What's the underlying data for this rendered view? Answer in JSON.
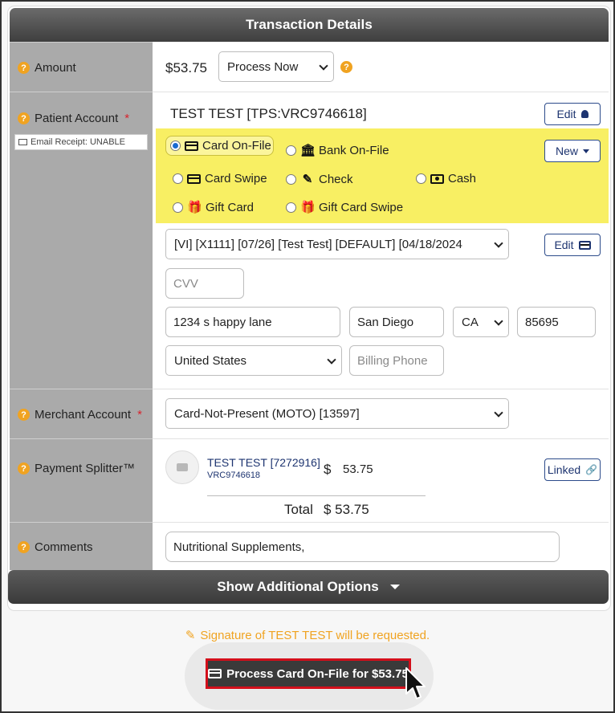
{
  "header": {
    "title": "Transaction Details"
  },
  "amount": {
    "label": "Amount",
    "value": "$53.75",
    "process_select": "Process Now"
  },
  "patient": {
    "label": "Patient Account",
    "required": "*",
    "email_receipt": "Email Receipt: UNABLE",
    "name": "TEST TEST [TPS:VRC9746618]",
    "edit_label": "Edit",
    "new_label": "New",
    "methods": [
      {
        "label": "Card On-File",
        "selected": true
      },
      {
        "label": "Bank On-File",
        "selected": false
      },
      {
        "label": "Card Swipe",
        "selected": false
      },
      {
        "label": "Check",
        "selected": false
      },
      {
        "label": "Cash",
        "selected": false
      },
      {
        "label": "Gift Card",
        "selected": false
      },
      {
        "label": "Gift Card Swipe",
        "selected": false
      }
    ],
    "card_select": "[VI] [X1111] [07/26] [Test Test] [DEFAULT] [04/18/2024",
    "card_edit_label": "Edit",
    "cvv_placeholder": "CVV",
    "address": "1234 s happy lane",
    "city": "San Diego",
    "state": "CA",
    "zip": "85695",
    "country": "United States",
    "billing_phone_placeholder": "Billing Phone"
  },
  "merchant": {
    "label": "Merchant Account",
    "required": "*",
    "value": "Card-Not-Present (MOTO) [13597]"
  },
  "splitter": {
    "label": "Payment Splitter™",
    "name": "TEST TEST [7272916]",
    "account": "VRC9746618",
    "currency": "$",
    "amount": "53.75",
    "linked_label": "Linked",
    "total_label": "Total",
    "total_value": "$ 53.75"
  },
  "comments": {
    "label": "Comments",
    "value": "Nutritional Supplements,"
  },
  "additional": {
    "label": "Show Additional Options"
  },
  "signature_note": "Signature of TEST TEST will be requested.",
  "process_button": "Process Card On-File for $53.75",
  "colors": {
    "accent": "#f0a321",
    "highlight": "#f8ef63",
    "primary_text": "#1d3470",
    "danger": "#d30f1b"
  }
}
